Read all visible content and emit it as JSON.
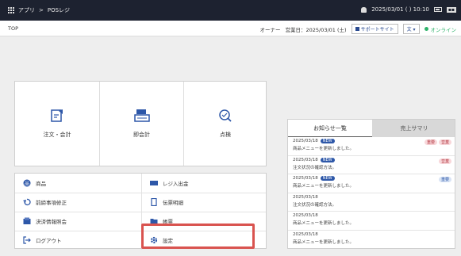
{
  "topbar": {
    "breadcrumb_app": "アプリ",
    "breadcrumb_sep": ">",
    "breadcrumb_current": "POSレジ",
    "datetime": "2025/03/01 ( ) 10:10"
  },
  "subbar": {
    "title": "TOP",
    "user": "オーナー",
    "business_date": "営業日：2025/03/01 (土)",
    "support": "サポートサイト",
    "lang": "文 ▾",
    "online": "オンライン"
  },
  "main_actions": [
    {
      "label": "注文・会計",
      "icon": "order-icon"
    },
    {
      "label": "即会計",
      "icon": "register-icon"
    },
    {
      "label": "点検",
      "icon": "inspect-icon"
    }
  ],
  "menu": [
    {
      "label": "商品",
      "icon": "product-icon"
    },
    {
      "label": "レジ入出金",
      "icon": "cash-icon"
    },
    {
      "label": "前締事項修正",
      "icon": "undo-icon"
    },
    {
      "label": "伝票明細",
      "icon": "slip-icon"
    },
    {
      "label": "決済情報照会",
      "icon": "payment-icon"
    },
    {
      "label": "帳票",
      "icon": "folder-icon"
    },
    {
      "label": "ログアウト",
      "icon": "logout-icon"
    },
    {
      "label": "設定",
      "icon": "gear-icon"
    }
  ],
  "news": {
    "tab_active": "お知らせ一覧",
    "tab_inactive": "売上サマリ",
    "items": [
      {
        "date": "2025/03/18",
        "new": "NEW",
        "text": "商品メニューを更新しました。",
        "tags": [
          "重要",
          "営業"
        ]
      },
      {
        "date": "2025/03/18",
        "new": "NEW",
        "text": "注文状況の確認方法。",
        "tags": [
          "営業"
        ]
      },
      {
        "date": "2025/03/18",
        "new": "NEW",
        "text": "商品メニューを更新しました。",
        "tags": [
          "重要"
        ]
      },
      {
        "date": "2025/03/18",
        "new": "",
        "text": "注文状況の確認方法。",
        "tags": []
      },
      {
        "date": "2025/03/18",
        "new": "",
        "text": "商品メニューを更新しました。",
        "tags": []
      },
      {
        "date": "2025/03/18",
        "new": "",
        "text": "商品メニューを更新しました。",
        "tags": []
      }
    ]
  },
  "colors": {
    "header_bg": "#1d2230",
    "accent_blue": "#2d57a8",
    "highlight_red": "#d9534f",
    "online_green": "#2fb36b"
  }
}
